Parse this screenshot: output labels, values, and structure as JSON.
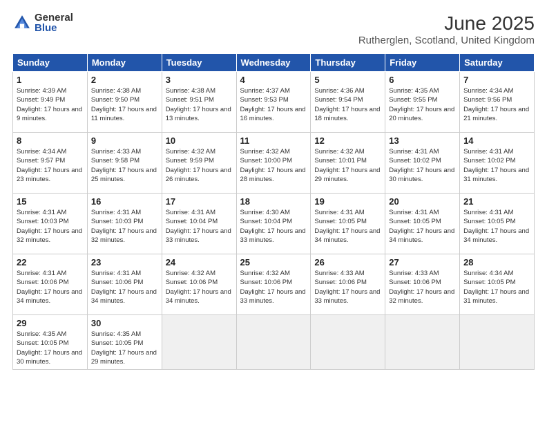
{
  "logo": {
    "general": "General",
    "blue": "Blue"
  },
  "title": "June 2025",
  "subtitle": "Rutherglen, Scotland, United Kingdom",
  "weekdays": [
    "Sunday",
    "Monday",
    "Tuesday",
    "Wednesday",
    "Thursday",
    "Friday",
    "Saturday"
  ],
  "weeks": [
    [
      {
        "day": 1,
        "sunrise": "4:39 AM",
        "sunset": "9:49 PM",
        "daylight": "17 hours and 9 minutes."
      },
      {
        "day": 2,
        "sunrise": "4:38 AM",
        "sunset": "9:50 PM",
        "daylight": "17 hours and 11 minutes."
      },
      {
        "day": 3,
        "sunrise": "4:38 AM",
        "sunset": "9:51 PM",
        "daylight": "17 hours and 13 minutes."
      },
      {
        "day": 4,
        "sunrise": "4:37 AM",
        "sunset": "9:53 PM",
        "daylight": "17 hours and 16 minutes."
      },
      {
        "day": 5,
        "sunrise": "4:36 AM",
        "sunset": "9:54 PM",
        "daylight": "17 hours and 18 minutes."
      },
      {
        "day": 6,
        "sunrise": "4:35 AM",
        "sunset": "9:55 PM",
        "daylight": "17 hours and 20 minutes."
      },
      {
        "day": 7,
        "sunrise": "4:34 AM",
        "sunset": "9:56 PM",
        "daylight": "17 hours and 21 minutes."
      }
    ],
    [
      {
        "day": 8,
        "sunrise": "4:34 AM",
        "sunset": "9:57 PM",
        "daylight": "17 hours and 23 minutes."
      },
      {
        "day": 9,
        "sunrise": "4:33 AM",
        "sunset": "9:58 PM",
        "daylight": "17 hours and 25 minutes."
      },
      {
        "day": 10,
        "sunrise": "4:32 AM",
        "sunset": "9:59 PM",
        "daylight": "17 hours and 26 minutes."
      },
      {
        "day": 11,
        "sunrise": "4:32 AM",
        "sunset": "10:00 PM",
        "daylight": "17 hours and 28 minutes."
      },
      {
        "day": 12,
        "sunrise": "4:32 AM",
        "sunset": "10:01 PM",
        "daylight": "17 hours and 29 minutes."
      },
      {
        "day": 13,
        "sunrise": "4:31 AM",
        "sunset": "10:02 PM",
        "daylight": "17 hours and 30 minutes."
      },
      {
        "day": 14,
        "sunrise": "4:31 AM",
        "sunset": "10:02 PM",
        "daylight": "17 hours and 31 minutes."
      }
    ],
    [
      {
        "day": 15,
        "sunrise": "4:31 AM",
        "sunset": "10:03 PM",
        "daylight": "17 hours and 32 minutes."
      },
      {
        "day": 16,
        "sunrise": "4:31 AM",
        "sunset": "10:03 PM",
        "daylight": "17 hours and 32 minutes."
      },
      {
        "day": 17,
        "sunrise": "4:31 AM",
        "sunset": "10:04 PM",
        "daylight": "17 hours and 33 minutes."
      },
      {
        "day": 18,
        "sunrise": "4:30 AM",
        "sunset": "10:04 PM",
        "daylight": "17 hours and 33 minutes."
      },
      {
        "day": 19,
        "sunrise": "4:31 AM",
        "sunset": "10:05 PM",
        "daylight": "17 hours and 34 minutes."
      },
      {
        "day": 20,
        "sunrise": "4:31 AM",
        "sunset": "10:05 PM",
        "daylight": "17 hours and 34 minutes."
      },
      {
        "day": 21,
        "sunrise": "4:31 AM",
        "sunset": "10:05 PM",
        "daylight": "17 hours and 34 minutes."
      }
    ],
    [
      {
        "day": 22,
        "sunrise": "4:31 AM",
        "sunset": "10:06 PM",
        "daylight": "17 hours and 34 minutes."
      },
      {
        "day": 23,
        "sunrise": "4:31 AM",
        "sunset": "10:06 PM",
        "daylight": "17 hours and 34 minutes."
      },
      {
        "day": 24,
        "sunrise": "4:32 AM",
        "sunset": "10:06 PM",
        "daylight": "17 hours and 34 minutes."
      },
      {
        "day": 25,
        "sunrise": "4:32 AM",
        "sunset": "10:06 PM",
        "daylight": "17 hours and 33 minutes."
      },
      {
        "day": 26,
        "sunrise": "4:33 AM",
        "sunset": "10:06 PM",
        "daylight": "17 hours and 33 minutes."
      },
      {
        "day": 27,
        "sunrise": "4:33 AM",
        "sunset": "10:06 PM",
        "daylight": "17 hours and 32 minutes."
      },
      {
        "day": 28,
        "sunrise": "4:34 AM",
        "sunset": "10:05 PM",
        "daylight": "17 hours and 31 minutes."
      }
    ],
    [
      {
        "day": 29,
        "sunrise": "4:35 AM",
        "sunset": "10:05 PM",
        "daylight": "17 hours and 30 minutes."
      },
      {
        "day": 30,
        "sunrise": "4:35 AM",
        "sunset": "10:05 PM",
        "daylight": "17 hours and 29 minutes."
      },
      null,
      null,
      null,
      null,
      null
    ]
  ]
}
